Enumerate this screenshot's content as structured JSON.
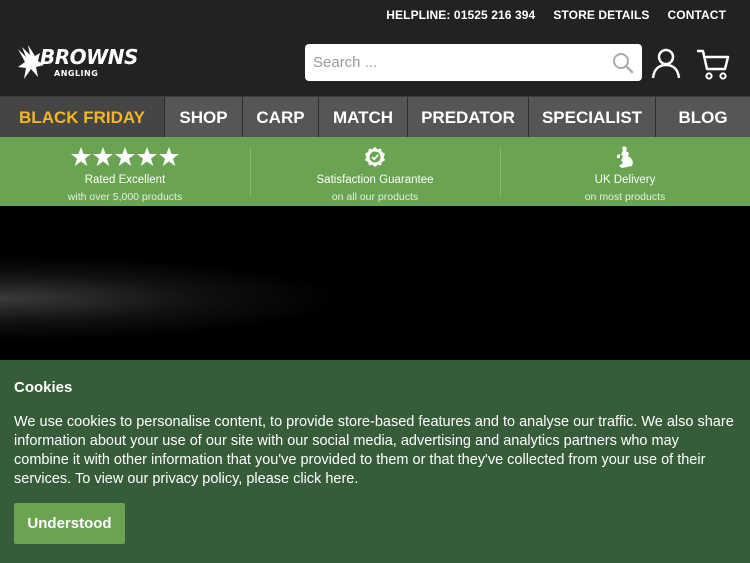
{
  "topbar": {
    "helpline": "HELPLINE: 01525 216 394",
    "store_details": "STORE DETAILS",
    "contact": "CONTACT"
  },
  "logo": {
    "brand": "BROWNS",
    "sub": "ANGLING"
  },
  "search": {
    "placeholder": "Search ...",
    "value": ""
  },
  "nav": {
    "items": [
      {
        "label": "BLACK FRIDAY"
      },
      {
        "label": "SHOP"
      },
      {
        "label": "CARP"
      },
      {
        "label": "MATCH"
      },
      {
        "label": "PREDATOR"
      },
      {
        "label": "SPECIALIST"
      },
      {
        "label": "BLOG"
      }
    ]
  },
  "trust": [
    {
      "title": "Rated Excellent",
      "subtitle": "with over 5,000 products",
      "icon": "five-stars-icon"
    },
    {
      "title": "Satisfaction Guarantee",
      "subtitle": "on all our products",
      "icon": "badge-check-icon"
    },
    {
      "title": "UK Delivery",
      "subtitle": "on most products",
      "icon": "uk-map-icon"
    }
  ],
  "cookie": {
    "title": "Cookies",
    "body": "We use cookies to personalise content, to provide store-based features and to analyse our traffic. We also share information about your use of our site with our social media, advertising and analytics partners who may combine it with other information that you've provided to them or that they've collected from your use of their services. To view our privacy policy, please click here.",
    "button": "Understood"
  },
  "colors": {
    "dark": "#222222",
    "nav": "#565656",
    "accent_yellow": "#f3b625",
    "green": "#6aa351",
    "cookie_bg": "#365c3a"
  }
}
